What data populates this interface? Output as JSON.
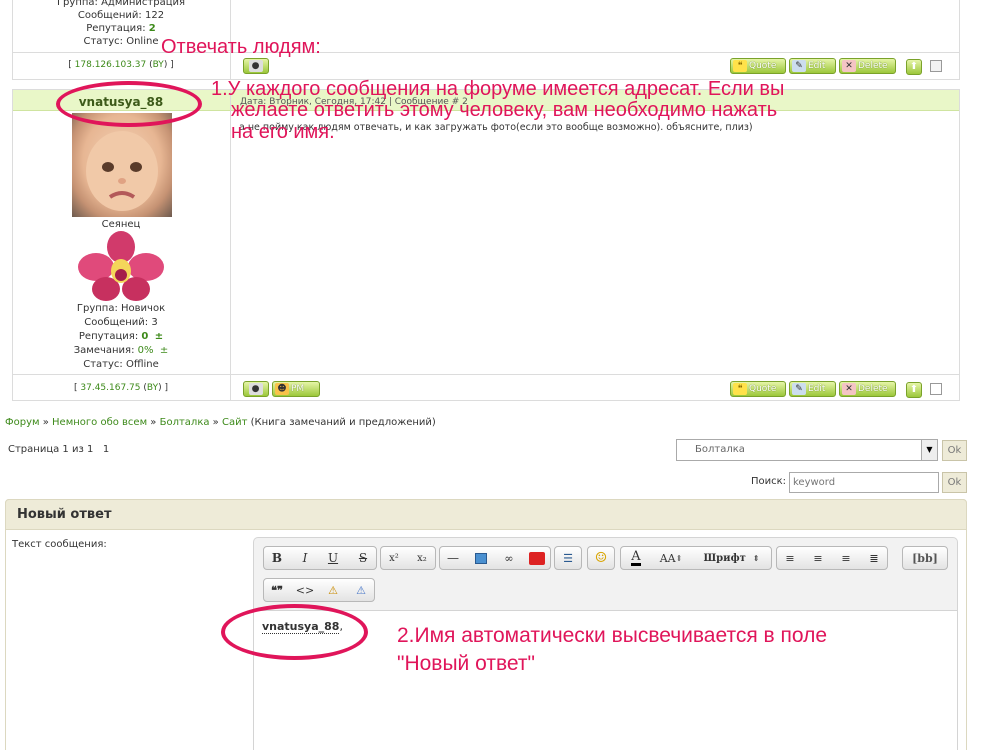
{
  "post1": {
    "group": "Группа: Администрация",
    "messages": "Сообщений: 122",
    "reputation_label": "Репутация: ",
    "reputation_value": "2",
    "status": "Статус: Online",
    "ip": "178.126.103.37",
    "country": "BY"
  },
  "post2": {
    "username": "vnatusya_88",
    "date": "Дата: Вторник, Сегодня, 17:42 | Сообщение # 2",
    "text": "а не пойму как людям отвечать, и как загружать фото(если это вообще возможно). объясните, плиз)",
    "rank": "Сеянец",
    "group": "Группа: Новичок",
    "messages": "Сообщений: 3",
    "reputation_label": "Репутация: ",
    "reputation_value": "0",
    "remarks_label": "Замечания: ",
    "remarks_value": "0%",
    "plusminus": "±",
    "status": "Статус: Offline",
    "ip": "37.45.167.75",
    "country": "BY"
  },
  "buttons": {
    "quote": "Quote",
    "edit": "Edit",
    "delete": "Delete",
    "pm": "PM"
  },
  "breadcrumb": {
    "forum": "Форум",
    "section": "Немного обо всем",
    "subforum": "Болталка",
    "topic": "Сайт",
    "topic_desc": " (Книга замечаний и предложений)",
    "sep": " » "
  },
  "pagination": {
    "label": "Страница 1 из 1",
    "page": "1"
  },
  "jump": {
    "selected": "Болталка",
    "ok": "Ok"
  },
  "search": {
    "label": "Поиск:",
    "placeholder": "keyword",
    "ok": "Ok"
  },
  "reply": {
    "title": "Новый ответ",
    "text_label": "Текст сообщения:",
    "content_name": "vnatusya_88",
    "content_rest": ","
  },
  "toolbar": {
    "bold": "B",
    "italic": "I",
    "underline": "U",
    "strike": "S",
    "sup": "x²",
    "sub": "x₂",
    "hr": "—",
    "font_size": "AA",
    "font": "Шрифт",
    "bbcode": "[bb]",
    "quote": "❝❞",
    "code": "<>"
  },
  "annotations": {
    "title": "Отвечать людям:",
    "step1_line1": "1.У каждого сообщения на форуме имеется адресат. Если вы",
    "step1_line2": "желаете ответить этому человеку, вам необходимо нажать",
    "step1_line3": "на его имя.",
    "step2_line1": "2.Имя автоматически высвечивается в поле",
    "step2_line2": "\"Новый ответ\""
  },
  "colors": {
    "accent_green": "#3d8a1a",
    "annotation_red": "#e0155a",
    "header_bg": "#eeebd8"
  }
}
